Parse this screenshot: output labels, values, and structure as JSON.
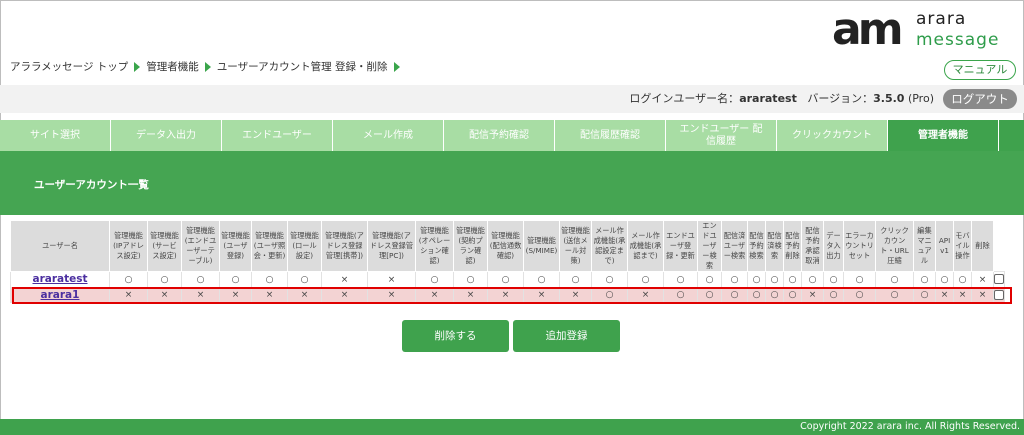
{
  "logo": {
    "mark": "am",
    "line1": "arara",
    "line2": "message",
    "brand_color": "#2e9c4a"
  },
  "breadcrumb": [
    {
      "label": "アララメッセージ トップ"
    },
    {
      "label": "管理者機能"
    },
    {
      "label": "ユーザーアカウント管理 登録・削除"
    }
  ],
  "manual_button": "マニュアル",
  "login": {
    "user_label": "ログインユーザー名：",
    "user_name": "araratest",
    "version_label": "バージョン：",
    "version": "3.5.0",
    "edition": "(Pro)"
  },
  "logout_button": "ログアウト",
  "tabs": [
    {
      "label": "サイト選択"
    },
    {
      "label": "データ入出力"
    },
    {
      "label": "エンドユーザー"
    },
    {
      "label": "メール作成"
    },
    {
      "label": "配信予約確認"
    },
    {
      "label": "配信履歴確認"
    },
    {
      "label": "エンドユーザー 配信履歴"
    },
    {
      "label": "クリックカウント"
    },
    {
      "label": "管理者機能",
      "active": true
    }
  ],
  "panel_title": "ユーザーアカウント一覧",
  "table": {
    "headers": [
      "ユーザー名",
      "管理機能(IPアドレス設定)",
      "管理機能(サービス設定)",
      "管理機能(エンドユーザーテーブル)",
      "管理機能(ユーザ登録)",
      "管理機能(ユーザ照会・更新)",
      "管理機能(ロール設定)",
      "管理機能(アドレス登録管理[携帯])",
      "管理機能(アドレス登録管理[PC])",
      "管理機能(オペレーション確認)",
      "管理機能(契約プラン確認)",
      "管理機能(配信通数確認)",
      "管理機能(S/MIME)",
      "管理機能(送信メール対策)",
      "メール作成機能(承認設定まで)",
      "メール作成機能(承認まで)",
      "エンドユーザ登録・更新",
      "エンドユーザー検索",
      "配信済ユーザー検索",
      "配信予約検索",
      "配信済検索",
      "配信予約削除",
      "配信予約承認取消",
      "データ入出力",
      "エラーカウントリセット",
      "クリックカウント・URL圧縮",
      "編集マニュアル",
      "API v1",
      "モバイル操作",
      "削除"
    ],
    "rows": [
      {
        "user": "araratest",
        "marks": [
          "○",
          "○",
          "○",
          "○",
          "○",
          "○",
          "×",
          "×",
          "○",
          "○",
          "○",
          "○",
          "○",
          "○",
          "○",
          "○",
          "○",
          "○",
          "○",
          "○",
          "○",
          "○",
          "○",
          "○",
          "○",
          "○",
          "○",
          "○",
          "×"
        ]
      },
      {
        "user": "arara1",
        "marks": [
          "×",
          "×",
          "×",
          "×",
          "×",
          "×",
          "×",
          "×",
          "×",
          "×",
          "×",
          "×",
          "×",
          "○",
          "×",
          "○",
          "○",
          "○",
          "○",
          "○",
          "○",
          "×",
          "○",
          "○",
          "○",
          "○",
          "×",
          "×",
          "×"
        ]
      }
    ]
  },
  "buttons": {
    "delete": "削除する",
    "add": "追加登録"
  },
  "footer": "Copyright 2022 arara inc. All Rights Reserved.",
  "colors": {
    "green": "#3fa24d",
    "tab_inactive": "#a8dda4",
    "highlight": "#e00000",
    "row_highlight": "#f3d3d3"
  }
}
